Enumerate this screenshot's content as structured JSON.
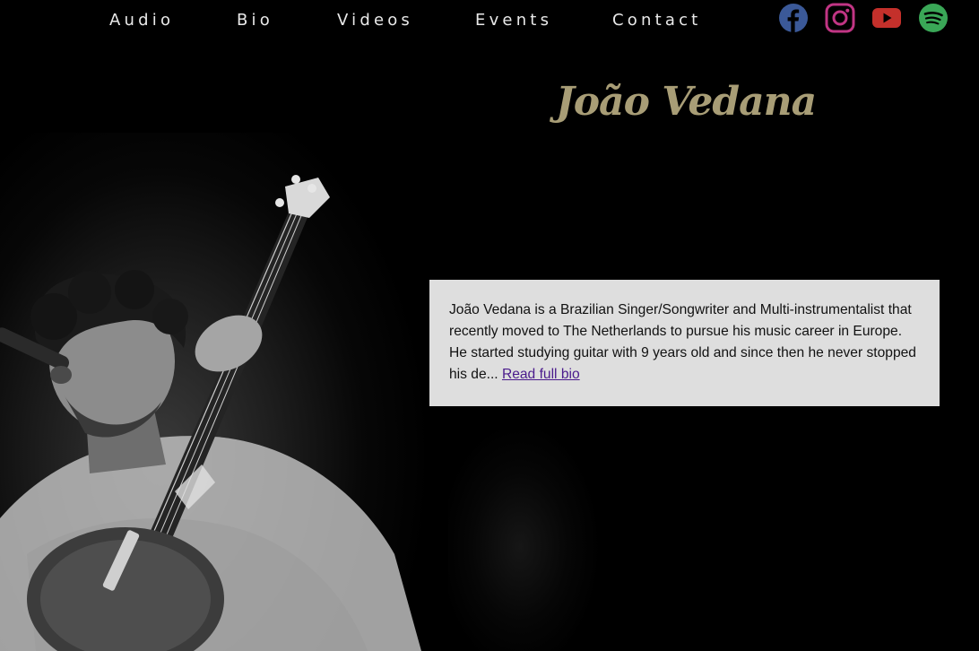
{
  "nav": {
    "items": [
      {
        "label": "Audio"
      },
      {
        "label": "Bio"
      },
      {
        "label": "Videos"
      },
      {
        "label": "Events"
      },
      {
        "label": "Contact"
      }
    ]
  },
  "social": {
    "items": [
      {
        "icon": "facebook-icon",
        "color": "#3b5998"
      },
      {
        "icon": "instagram-icon",
        "color": "#c13584"
      },
      {
        "icon": "youtube-icon",
        "color": "#c4302b"
      },
      {
        "icon": "spotify-icon",
        "color": "#3aa757"
      }
    ]
  },
  "hero": {
    "title": "João Vedana",
    "title_color": "#a89d76"
  },
  "bio": {
    "text": "João Vedana is a Brazilian Singer/Songwriter and Multi-instrumentalist that recently moved to The Netherlands to pursue his music career in Europe. He started studying guitar with 9 years old and since then he never stopped his de... ",
    "link_label": "Read full bio",
    "card_color": "#dedede"
  }
}
